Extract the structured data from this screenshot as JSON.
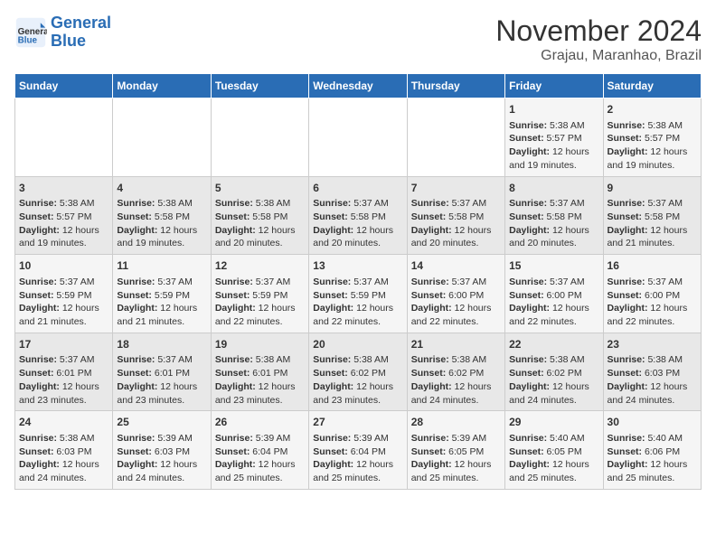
{
  "header": {
    "logo_line1": "General",
    "logo_line2": "Blue",
    "month": "November 2024",
    "location": "Grajau, Maranhao, Brazil"
  },
  "weekdays": [
    "Sunday",
    "Monday",
    "Tuesday",
    "Wednesday",
    "Thursday",
    "Friday",
    "Saturday"
  ],
  "weeks": [
    [
      {
        "day": "",
        "info": ""
      },
      {
        "day": "",
        "info": ""
      },
      {
        "day": "",
        "info": ""
      },
      {
        "day": "",
        "info": ""
      },
      {
        "day": "",
        "info": ""
      },
      {
        "day": "1",
        "info": "Sunrise: 5:38 AM\nSunset: 5:57 PM\nDaylight: 12 hours and 19 minutes."
      },
      {
        "day": "2",
        "info": "Sunrise: 5:38 AM\nSunset: 5:57 PM\nDaylight: 12 hours and 19 minutes."
      }
    ],
    [
      {
        "day": "3",
        "info": "Sunrise: 5:38 AM\nSunset: 5:57 PM\nDaylight: 12 hours and 19 minutes."
      },
      {
        "day": "4",
        "info": "Sunrise: 5:38 AM\nSunset: 5:58 PM\nDaylight: 12 hours and 19 minutes."
      },
      {
        "day": "5",
        "info": "Sunrise: 5:38 AM\nSunset: 5:58 PM\nDaylight: 12 hours and 20 minutes."
      },
      {
        "day": "6",
        "info": "Sunrise: 5:37 AM\nSunset: 5:58 PM\nDaylight: 12 hours and 20 minutes."
      },
      {
        "day": "7",
        "info": "Sunrise: 5:37 AM\nSunset: 5:58 PM\nDaylight: 12 hours and 20 minutes."
      },
      {
        "day": "8",
        "info": "Sunrise: 5:37 AM\nSunset: 5:58 PM\nDaylight: 12 hours and 20 minutes."
      },
      {
        "day": "9",
        "info": "Sunrise: 5:37 AM\nSunset: 5:58 PM\nDaylight: 12 hours and 21 minutes."
      }
    ],
    [
      {
        "day": "10",
        "info": "Sunrise: 5:37 AM\nSunset: 5:59 PM\nDaylight: 12 hours and 21 minutes."
      },
      {
        "day": "11",
        "info": "Sunrise: 5:37 AM\nSunset: 5:59 PM\nDaylight: 12 hours and 21 minutes."
      },
      {
        "day": "12",
        "info": "Sunrise: 5:37 AM\nSunset: 5:59 PM\nDaylight: 12 hours and 22 minutes."
      },
      {
        "day": "13",
        "info": "Sunrise: 5:37 AM\nSunset: 5:59 PM\nDaylight: 12 hours and 22 minutes."
      },
      {
        "day": "14",
        "info": "Sunrise: 5:37 AM\nSunset: 6:00 PM\nDaylight: 12 hours and 22 minutes."
      },
      {
        "day": "15",
        "info": "Sunrise: 5:37 AM\nSunset: 6:00 PM\nDaylight: 12 hours and 22 minutes."
      },
      {
        "day": "16",
        "info": "Sunrise: 5:37 AM\nSunset: 6:00 PM\nDaylight: 12 hours and 22 minutes."
      }
    ],
    [
      {
        "day": "17",
        "info": "Sunrise: 5:37 AM\nSunset: 6:01 PM\nDaylight: 12 hours and 23 minutes."
      },
      {
        "day": "18",
        "info": "Sunrise: 5:37 AM\nSunset: 6:01 PM\nDaylight: 12 hours and 23 minutes."
      },
      {
        "day": "19",
        "info": "Sunrise: 5:38 AM\nSunset: 6:01 PM\nDaylight: 12 hours and 23 minutes."
      },
      {
        "day": "20",
        "info": "Sunrise: 5:38 AM\nSunset: 6:02 PM\nDaylight: 12 hours and 23 minutes."
      },
      {
        "day": "21",
        "info": "Sunrise: 5:38 AM\nSunset: 6:02 PM\nDaylight: 12 hours and 24 minutes."
      },
      {
        "day": "22",
        "info": "Sunrise: 5:38 AM\nSunset: 6:02 PM\nDaylight: 12 hours and 24 minutes."
      },
      {
        "day": "23",
        "info": "Sunrise: 5:38 AM\nSunset: 6:03 PM\nDaylight: 12 hours and 24 minutes."
      }
    ],
    [
      {
        "day": "24",
        "info": "Sunrise: 5:38 AM\nSunset: 6:03 PM\nDaylight: 12 hours and 24 minutes."
      },
      {
        "day": "25",
        "info": "Sunrise: 5:39 AM\nSunset: 6:03 PM\nDaylight: 12 hours and 24 minutes."
      },
      {
        "day": "26",
        "info": "Sunrise: 5:39 AM\nSunset: 6:04 PM\nDaylight: 12 hours and 25 minutes."
      },
      {
        "day": "27",
        "info": "Sunrise: 5:39 AM\nSunset: 6:04 PM\nDaylight: 12 hours and 25 minutes."
      },
      {
        "day": "28",
        "info": "Sunrise: 5:39 AM\nSunset: 6:05 PM\nDaylight: 12 hours and 25 minutes."
      },
      {
        "day": "29",
        "info": "Sunrise: 5:40 AM\nSunset: 6:05 PM\nDaylight: 12 hours and 25 minutes."
      },
      {
        "day": "30",
        "info": "Sunrise: 5:40 AM\nSunset: 6:06 PM\nDaylight: 12 hours and 25 minutes."
      }
    ]
  ]
}
